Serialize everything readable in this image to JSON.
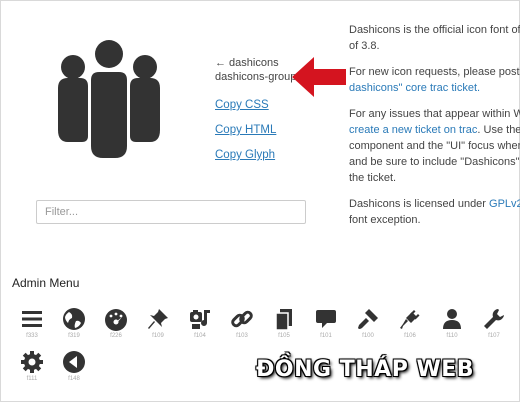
{
  "preview": {
    "icon_name": "groups-icon",
    "back_label": "← dashicons",
    "class_name": "dashicons-groups",
    "copy_css": "Copy CSS",
    "copy_html": "Copy HTML",
    "copy_glyph": "Copy Glyph"
  },
  "filter": {
    "placeholder": "Filter..."
  },
  "info": {
    "p1_line1": "Dashicons is the official icon font of",
    "p1_line2": "of 3.8.",
    "p2_line1": "For new icon requests, please post to",
    "p2_link": "dashicons\" core trac ticket.",
    "p3_line1": "For any issues that appear within Wo",
    "p3_link": "create a new ticket on trac",
    "p3_line2_rest": ". Use the \"",
    "p3_line3": "component and the \"UI\" focus when",
    "p3_line4": "and be sure to include \"Dashicons\" s",
    "p3_line5": "the ticket.",
    "p4_line1_a": "Dashicons is licensed under ",
    "p4_link": "GPLv2",
    "p4_line1_b": ", c",
    "p4_line2": "font exception."
  },
  "section_title": "Admin Menu",
  "icons": [
    {
      "name": "menu-icon",
      "code": "f333"
    },
    {
      "name": "globe-icon",
      "code": "f319"
    },
    {
      "name": "dashboard-icon",
      "code": "f226"
    },
    {
      "name": "pin-icon",
      "code": "f109"
    },
    {
      "name": "media-icon",
      "code": "f104"
    },
    {
      "name": "link-icon",
      "code": "f103"
    },
    {
      "name": "pages-icon",
      "code": "f105"
    },
    {
      "name": "comments-icon",
      "code": "f101"
    },
    {
      "name": "appearance-icon",
      "code": "f100"
    },
    {
      "name": "plugins-icon",
      "code": "f106"
    },
    {
      "name": "users-icon",
      "code": "f110"
    },
    {
      "name": "tools-icon",
      "code": "f107"
    },
    {
      "name": "settings-icon",
      "code": "f111"
    },
    {
      "name": "collapse-icon",
      "code": "f148"
    }
  ],
  "watermark": "ĐỒNG THÁP WEB",
  "colors": {
    "link": "#2a7ab8",
    "arrow": "#d4141f",
    "icon": "#333333"
  }
}
